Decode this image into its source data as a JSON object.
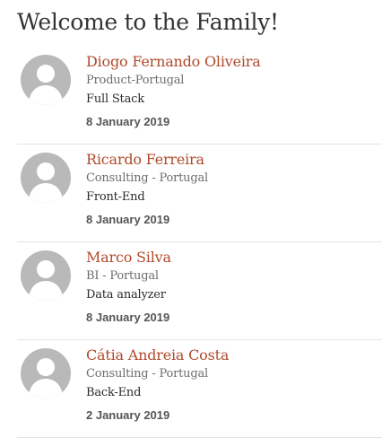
{
  "page": {
    "title": "Welcome to the Family!"
  },
  "colors": {
    "name": "#b04a2a",
    "department": "#6d6d6d",
    "role": "#2b2b2b",
    "date": "#555555",
    "avatar_bg": "#b9b9b9",
    "divider": "#e3e3e3"
  },
  "people": [
    {
      "avatar_icon": "default-user-avatar-icon",
      "name": "Diogo Fernando Oliveira",
      "department": "Product-Portugal",
      "role": "Full Stack",
      "date": "8 January 2019"
    },
    {
      "avatar_icon": "default-user-avatar-icon",
      "name": "Ricardo Ferreira",
      "department": "Consulting - Portugal",
      "role": "Front-End",
      "date": "8 January 2019"
    },
    {
      "avatar_icon": "default-user-avatar-icon",
      "name": "Marco Silva",
      "department": "BI - Portugal",
      "role": "Data analyzer",
      "date": "8 January 2019"
    },
    {
      "avatar_icon": "default-user-avatar-icon",
      "name": "Cátia Andreia Costa",
      "department": "Consulting - Portugal",
      "role": "Back-End",
      "date": "2 January 2019"
    }
  ]
}
